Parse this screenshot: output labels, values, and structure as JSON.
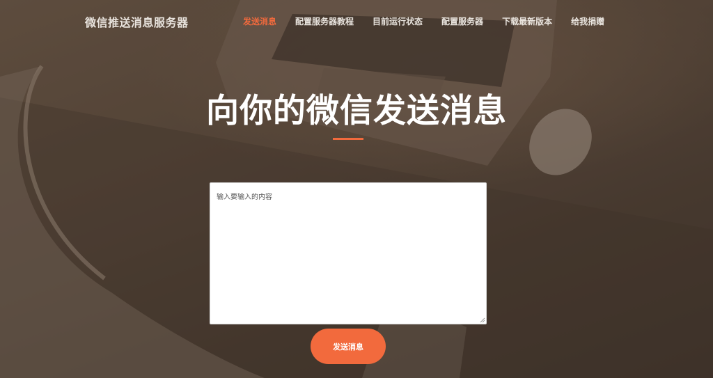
{
  "nav": {
    "brand": "微信推送消息服务器",
    "items": [
      {
        "label": "发送消息",
        "active": true
      },
      {
        "label": "配置服务器教程",
        "active": false
      },
      {
        "label": "目前运行状态",
        "active": false
      },
      {
        "label": "配置服务器",
        "active": false
      },
      {
        "label": "下载最新版本",
        "active": false
      },
      {
        "label": "给我捐赠",
        "active": false
      }
    ]
  },
  "hero": {
    "title": "向你的微信发送消息"
  },
  "form": {
    "message_value": "",
    "message_placeholder": "输入要输入的内容",
    "submit_label": "发送消息"
  },
  "colors": {
    "accent": "#f26a3d",
    "text_light": "#e9e4de",
    "overlay_base": "#4e4036"
  }
}
